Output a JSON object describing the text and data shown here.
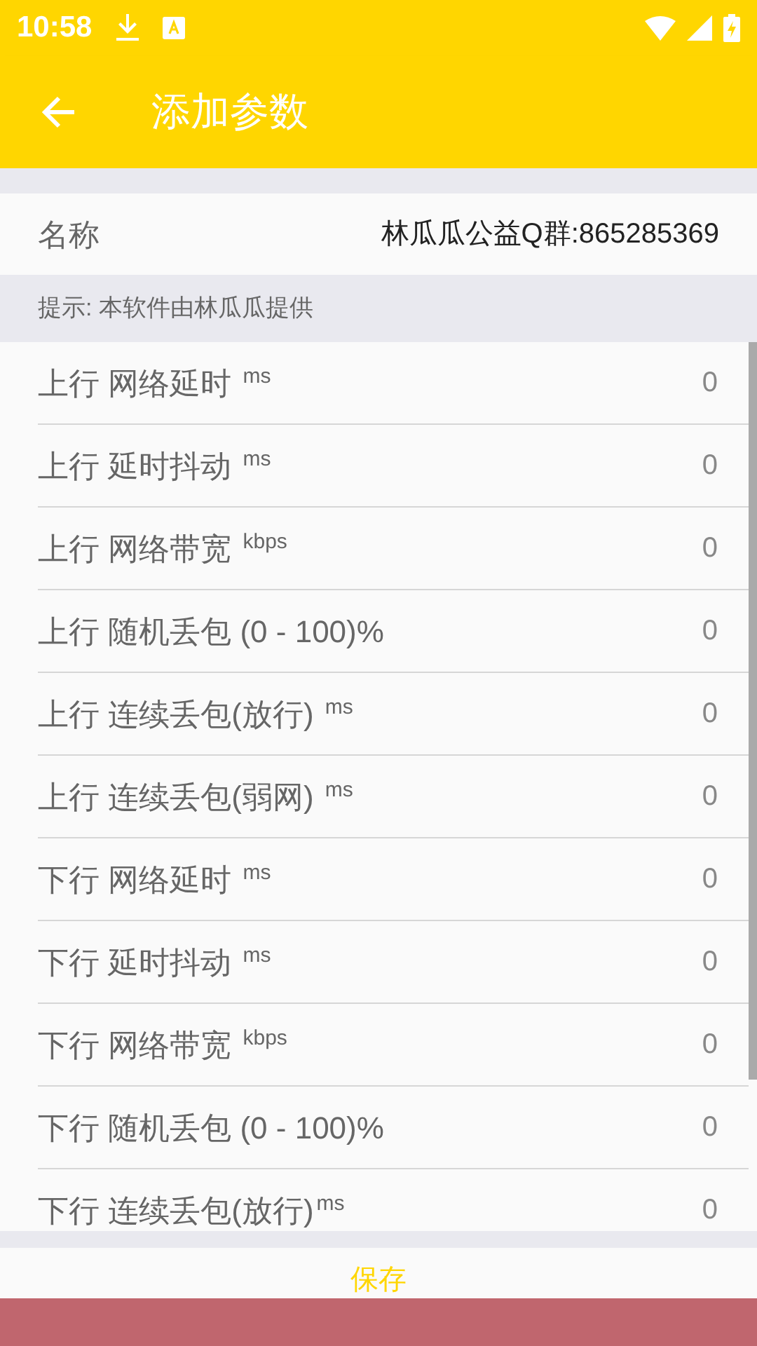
{
  "status_bar": {
    "time": "10:58"
  },
  "app_bar": {
    "title": "添加参数"
  },
  "name_row": {
    "label": "名称",
    "value": "林瓜瓜公益Q群:865285369"
  },
  "hint": "提示: 本软件由林瓜瓜提供",
  "params": [
    {
      "label": "上行 网络延时 $^{ms}$",
      "value": "0"
    },
    {
      "label": "上行 延时抖动 $^{ms}$",
      "value": "0"
    },
    {
      "label": "上行 网络带宽 $^{kbps}$",
      "value": "0"
    },
    {
      "label": "上行 随机丢包 (0 - 100)%",
      "value": "0"
    },
    {
      "label": "上行 连续丢包(放行) $^{ms}$",
      "value": "0"
    },
    {
      "label": "上行 连续丢包(弱网) $^{ms}$",
      "value": "0"
    },
    {
      "label": "下行 网络延时 $^{ms}$",
      "value": "0"
    },
    {
      "label": "下行 延时抖动 $^{ms}$",
      "value": "0"
    },
    {
      "label": "下行 网络带宽 $^{kbps}$",
      "value": "0"
    },
    {
      "label": "下行 随机丢包 (0 - 100)%",
      "value": "0"
    },
    {
      "label": "下行 连续丢包(放行)$^{ms}$",
      "value": "0"
    }
  ],
  "save_button": "保存"
}
